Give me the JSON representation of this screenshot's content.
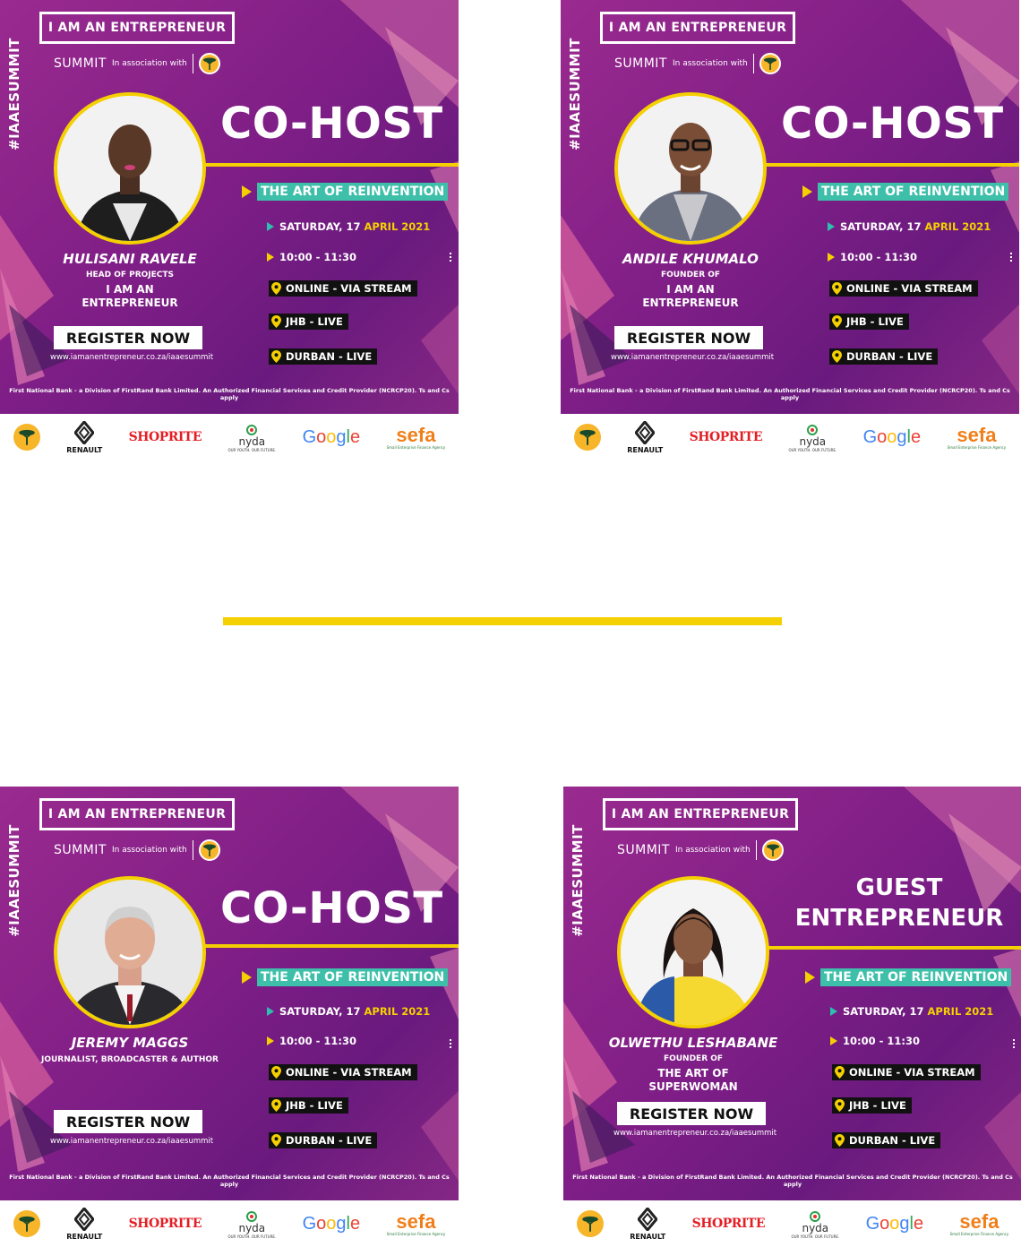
{
  "common": {
    "hashtag": "#IAAESUMMIT",
    "brand": "I AM AN ENTREPRENEUR",
    "summit": "SUMMIT",
    "association": "In association with",
    "theme": "THE ART OF REINVENTION",
    "date_prefix": "SATURDAY, 17 ",
    "date_highlight": "APRIL 2021",
    "time": "10:00 - 11:30",
    "locations": [
      "ONLINE - VIA STREAM",
      "JHB - LIVE",
      "DURBAN - LIVE"
    ],
    "register": "REGISTER NOW",
    "url": "www.iamanentrepreneur.co.za/iaaesummit",
    "disclaimer": "First National Bank - a Division of FirstRand Bank Limited. An Authorized Financial Services and Credit Provider (NCRCP20). Ts and Cs apply",
    "sponsors": {
      "renault": "RENAULT",
      "shoprite": "SHOPRITE",
      "nyda": "nyda",
      "nyda_sub": "OUR YOUTH. OUR FUTURE.",
      "google_letters": [
        "G",
        "o",
        "o",
        "g",
        "l",
        "e"
      ],
      "sefa": "sefa",
      "sefa_sub": "Small Enterprise Finance Agency"
    },
    "colors": {
      "purple": "#7e1e86",
      "yellow": "#f5d000",
      "teal": "#3dbfa9"
    }
  },
  "cards": [
    {
      "headline": "CO-HOST",
      "name": "HULISANI RAVELE",
      "role": "HEAD OF PROJECTS",
      "company_1": "I AM AN",
      "company_2": "ENTREPRENEUR"
    },
    {
      "headline": "CO-HOST",
      "name": "ANDILE KHUMALO",
      "role": "FOUNDER OF",
      "company_1": "I AM AN",
      "company_2": "ENTREPRENEUR"
    },
    {
      "headline": "CO-HOST",
      "name": "JEREMY MAGGS",
      "role": "JOURNALIST, BROADCASTER & AUTHOR",
      "company_1": "",
      "company_2": ""
    },
    {
      "headline_1": "GUEST",
      "headline_2": "ENTREPRENEUR",
      "name": "OLWETHU LESHABANE",
      "role": "FOUNDER OF",
      "company_1": "THE ART OF",
      "company_2": "SUPERWOMAN"
    }
  ]
}
